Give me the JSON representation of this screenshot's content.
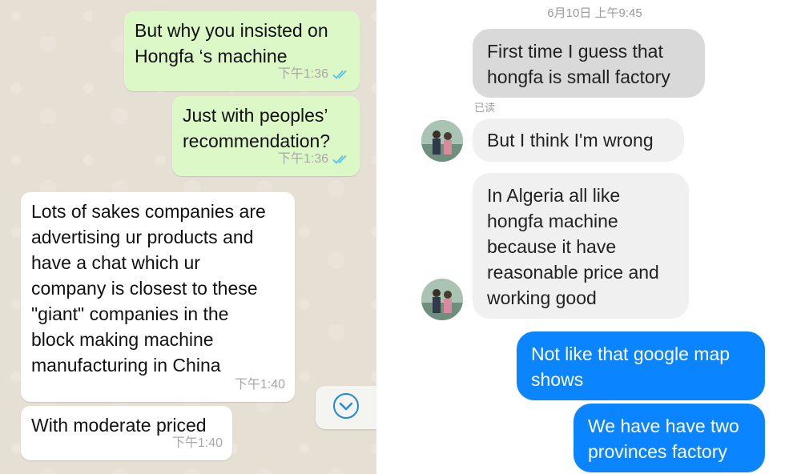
{
  "whatsapp": {
    "messages": [
      {
        "direction": "outgoing",
        "text": "But why you insisted on\nHongfa ‘s machine",
        "time": "下午1:36",
        "read": true
      },
      {
        "direction": "outgoing",
        "text": "Just with peoples’\nrecommendation?",
        "time": "下午1:36",
        "read": true
      },
      {
        "direction": "incoming",
        "text": "Lots of sakes companies are\nadvertising ur products and\nhave a chat which ur\ncompany is closest to these\n\"giant\" companies in the\nblock making machine\nmanufacturing in China",
        "time": "下午1:40"
      },
      {
        "direction": "incoming",
        "text": "With moderate priced",
        "time": "下午1:40"
      }
    ],
    "scroll_button_icon": "chevron-down-circle-icon",
    "colors": {
      "outgoing": "#dcf8c6",
      "incoming": "#ffffff",
      "ticks": "#4fc3f7"
    }
  },
  "messenger": {
    "timestamp": "6月10日 上午9:45",
    "read_receipt": "已读",
    "messages": [
      {
        "direction": "outgoing-grey",
        "text": "First time I guess that\nhongfa is small factory"
      },
      {
        "direction": "incoming",
        "text": "But I think I'm wrong",
        "avatar": true
      },
      {
        "direction": "incoming",
        "text": "In Algeria all like\nhongfa machine\nbecause it have\nreasonable price and\nworking good",
        "avatar": true
      },
      {
        "direction": "outgoing",
        "text": "Not like that google map\nshows"
      },
      {
        "direction": "outgoing",
        "text": "We have have two\nprovinces factory"
      }
    ],
    "colors": {
      "outgoing": "#0a84ff",
      "incoming": "#f0f0f0",
      "grey": "#d9d9d9"
    }
  }
}
